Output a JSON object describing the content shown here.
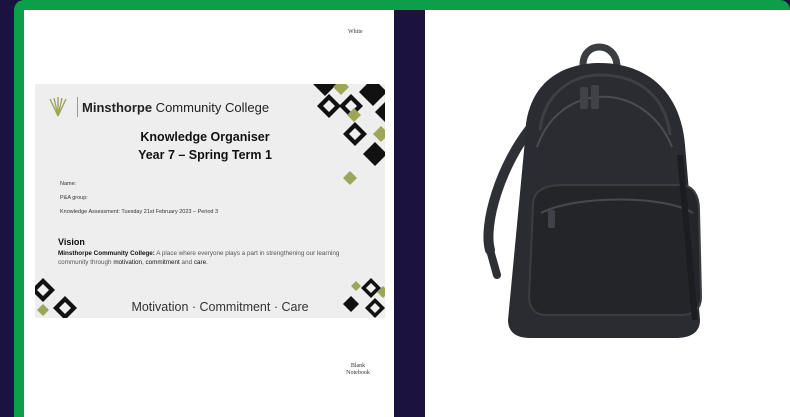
{
  "left_panel": {
    "top_label": "White",
    "bottom_label_line1": "Blank",
    "bottom_label_line2": "Notebook",
    "cover": {
      "college_bold": "Minsthorpe",
      "college_rest": " Community College",
      "title_line1": "Knowledge Organiser",
      "title_line2": "Year 7 – Spring Term 1",
      "field_name": "Name:",
      "field_group": "P&A group:",
      "field_assessment": "Knowledge Assessment: Tuesday 21st February 2023 – Period 3",
      "vision_heading": "Vision",
      "vision_lead": "Minsthorpe Community College:",
      "vision_text_1": " A place where everyone plays a part in strengthening our learning community through ",
      "vision_kw1": "motivation",
      "vision_sep": ", ",
      "vision_kw2": "commitment",
      "vision_and": " and ",
      "vision_kw3": "care",
      "vision_end": ".",
      "motto": "Motivation · Commitment · Care"
    }
  },
  "right_panel": {
    "image": "black-backpack"
  },
  "colors": {
    "border_green": "#0c9e48",
    "background_navy": "#1b123f",
    "diamond_dark": "#111111",
    "diamond_olive": "#9da55a"
  }
}
